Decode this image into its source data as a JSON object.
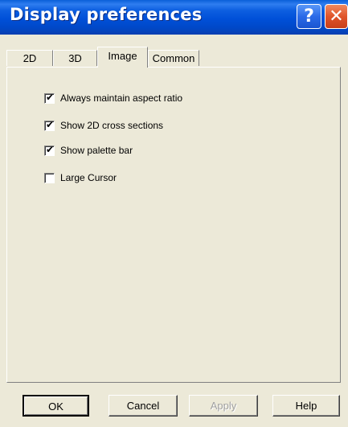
{
  "window": {
    "title": "Display preferences",
    "help_glyph": "?",
    "close_glyph": "✕"
  },
  "tabs": [
    {
      "label": "2D",
      "active": false
    },
    {
      "label": "3D",
      "active": false
    },
    {
      "label": "Image",
      "active": true
    },
    {
      "label": "Common",
      "active": false
    }
  ],
  "options": [
    {
      "label": "Always maintain aspect ratio",
      "checked": true
    },
    {
      "label": "Show 2D cross sections",
      "checked": true
    },
    {
      "label": "Show palette bar",
      "checked": true
    },
    {
      "label": "Large Cursor",
      "checked": false
    }
  ],
  "buttons": {
    "ok": "OK",
    "cancel": "Cancel",
    "apply": "Apply",
    "help": "Help"
  },
  "icons": {
    "help": "help-icon",
    "close": "close-icon",
    "check": "✔"
  }
}
